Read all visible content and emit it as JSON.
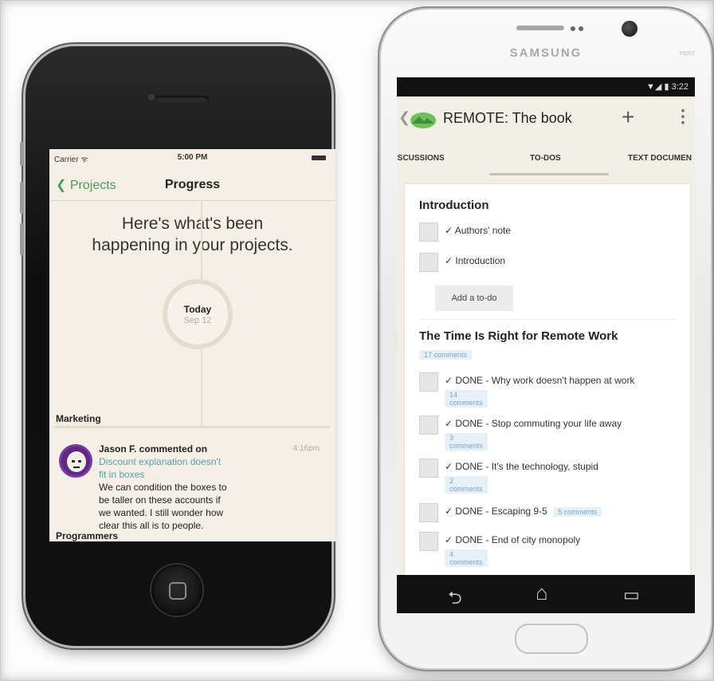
{
  "iphone": {
    "status": {
      "carrier": "Carrier ᯤ",
      "time": "5:00 PM"
    },
    "nav": {
      "back": "❮",
      "back_label": "Projects",
      "title": "Progress"
    },
    "headline_1": "Here's what's been",
    "headline_2": "happening in your projects.",
    "timeline": {
      "day": "Today",
      "date": "Sep 12"
    },
    "section_marketing": "Marketing",
    "comment": {
      "author_line": "Jason F. commented on",
      "link_1": "Discount explanation doesn't",
      "link_2": "fit in boxes",
      "body_1": "We can condition the boxes to",
      "body_2": "be taller on these accounts if",
      "body_3": "we wanted. I still wonder how",
      "body_4": "clear this all is to people.",
      "time": "4:16pm"
    },
    "section_programmers": "Programmers"
  },
  "samsung": {
    "brand": "SAMSUNG",
    "model": "#5001",
    "status": {
      "time": "3:22"
    },
    "appbar": {
      "back": "❮",
      "title": "REMOTE: The book",
      "plus": "+",
      "more": "⋮"
    },
    "tabs": [
      "ISCUSSIONS",
      "TO-DOS",
      "TEXT DOCUMEN"
    ],
    "lists": [
      {
        "title": "Introduction",
        "items": [
          {
            "text": "✓ Authors' note"
          },
          {
            "text": "✓ Introduction"
          }
        ],
        "add_label": "Add a to-do"
      },
      {
        "title": "The Time Is Right for Remote Work",
        "comments": "17 comments",
        "items": [
          {
            "text": "✓ DONE - Why work doesn't happen at work",
            "comments": "14 comments"
          },
          {
            "text": "✓ DONE - Stop commuting your life away",
            "comments": "3 comments"
          },
          {
            "text": "✓ DONE - It's the technology, stupid",
            "comments": "2 comments"
          },
          {
            "text": "✓ DONE - Escaping 9-5",
            "comments": "5 comments"
          },
          {
            "text": "✓ DONE - End of city monopoly",
            "comments": "4 comments"
          }
        ]
      }
    ],
    "nav": {
      "back": "⮌",
      "home": "⌂",
      "recent": "▭"
    }
  }
}
